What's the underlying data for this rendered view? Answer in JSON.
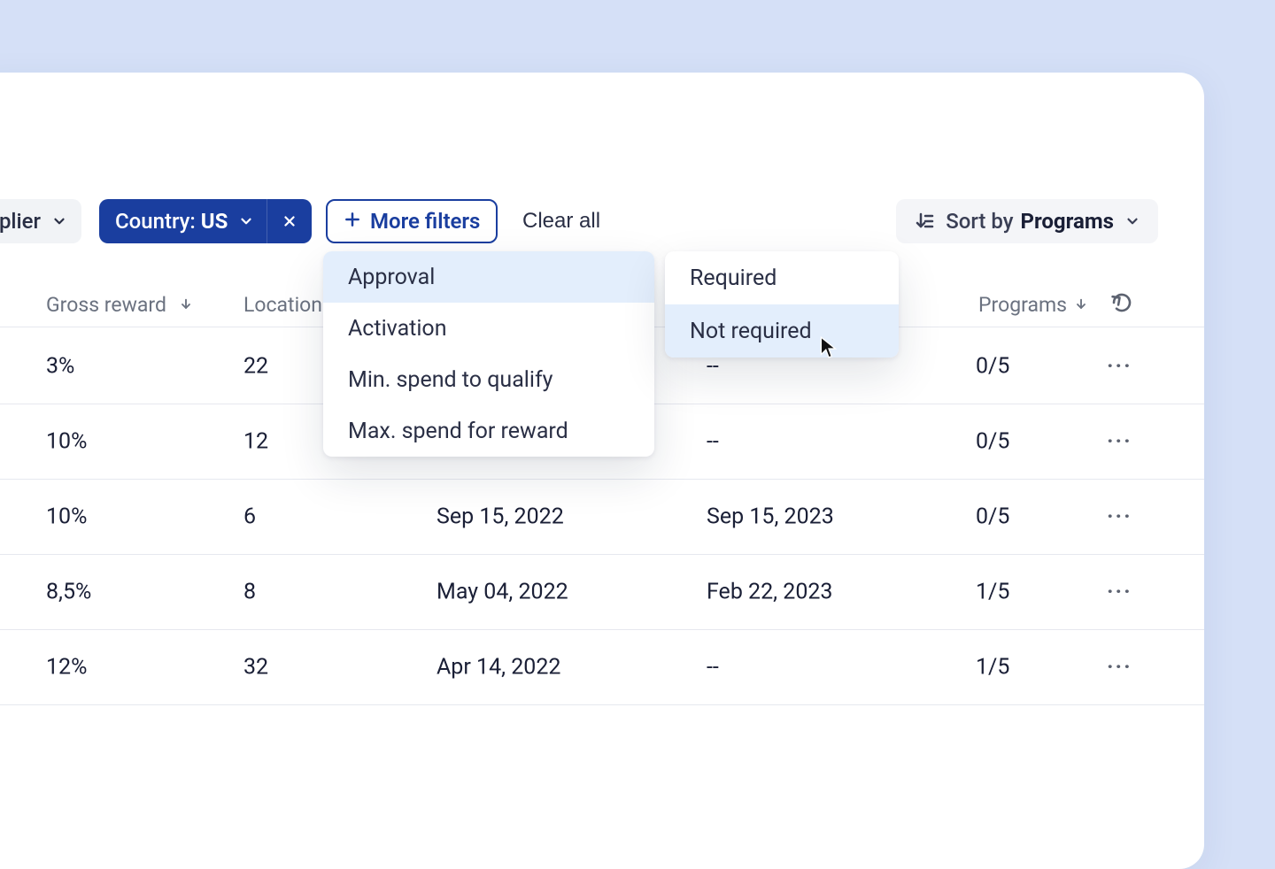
{
  "toolbar": {
    "supplier_label_suffix": "plier",
    "country_label": "Country:",
    "country_value": "US",
    "more_filters_label": "More filters",
    "clear_all_label": "Clear all",
    "sort_by_label": "Sort by",
    "sort_value": "Programs"
  },
  "filter_menu": {
    "items": [
      "Approval",
      "Activation",
      "Min. spend to qualify",
      "Max. spend for reward"
    ],
    "highlighted_index": 0
  },
  "approval_menu": {
    "items": [
      "Required",
      "Not required"
    ],
    "highlighted_index": 1
  },
  "columns": {
    "reward": "Gross reward",
    "locations": "Locations",
    "programs": "Programs"
  },
  "rows": [
    {
      "reward": "3%",
      "locations": "22",
      "start": "",
      "end": "--",
      "programs": "0/5"
    },
    {
      "reward": "10%",
      "locations": "12",
      "start": "",
      "end": "--",
      "programs": "0/5"
    },
    {
      "reward": "10%",
      "locations": "6",
      "start": "Sep 15, 2022",
      "end": "Sep 15, 2023",
      "programs": "0/5"
    },
    {
      "reward": "8,5%",
      "locations": "8",
      "start": "May 04, 2022",
      "end": "Feb 22, 2023",
      "programs": "1/5"
    },
    {
      "reward": "12%",
      "locations": "32",
      "start": "Apr 14, 2022",
      "end": "--",
      "programs": "1/5"
    }
  ],
  "glyphs": {
    "ellipsis": "···"
  }
}
